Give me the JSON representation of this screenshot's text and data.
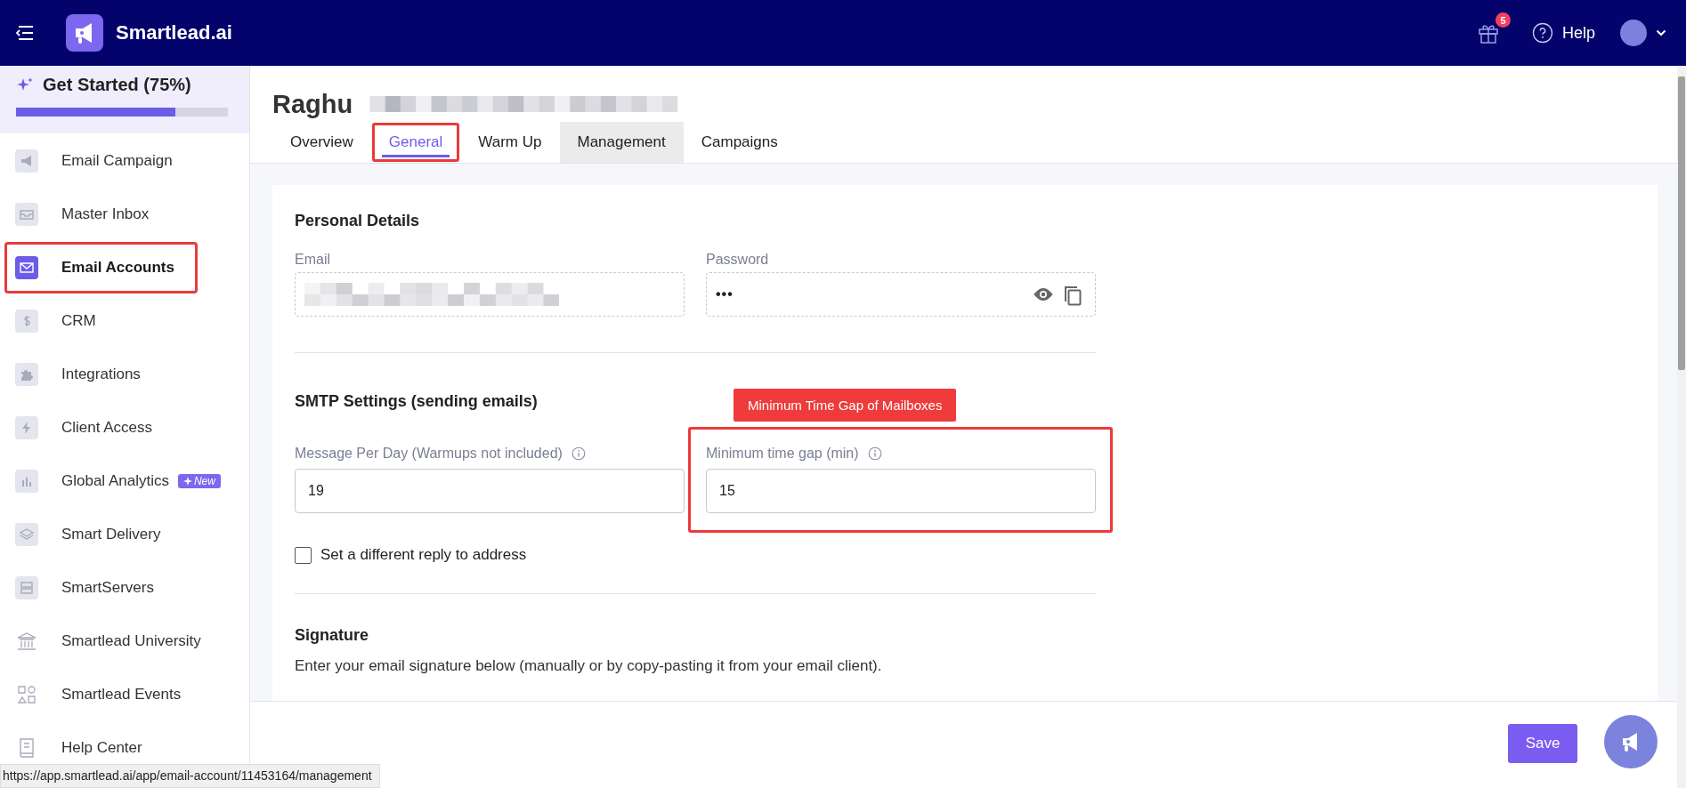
{
  "topbar": {
    "brand": "Smartlead.ai",
    "gift_badge": "5",
    "help": "Help"
  },
  "sidebar": {
    "get_started": {
      "label": "Get Started (75%)",
      "level": 0.75
    },
    "items": [
      {
        "label": "Email Campaign",
        "selected": false,
        "highlighted": false
      },
      {
        "label": "Master Inbox",
        "selected": false,
        "highlighted": false
      },
      {
        "label": "Email Accounts",
        "selected": true,
        "highlighted": true
      },
      {
        "label": "CRM",
        "selected": false,
        "highlighted": false
      },
      {
        "label": "Integrations",
        "selected": false,
        "highlighted": false
      },
      {
        "label": "Client Access",
        "selected": false,
        "highlighted": false
      },
      {
        "label": "Global Analytics",
        "selected": false,
        "highlighted": false,
        "badge": "New"
      },
      {
        "label": "Smart Delivery",
        "selected": false,
        "highlighted": false
      },
      {
        "label": "SmartServers",
        "selected": false,
        "highlighted": false
      },
      {
        "label": "Smartlead University",
        "selected": false,
        "highlighted": false
      },
      {
        "label": "Smartlead Events",
        "selected": false,
        "highlighted": false
      },
      {
        "label": "Help Center",
        "selected": false,
        "highlighted": false
      }
    ]
  },
  "page": {
    "title": "Raghu",
    "tabs": [
      {
        "label": "Overview",
        "selected": false,
        "hovered": false,
        "highlighted": false
      },
      {
        "label": "General",
        "selected": true,
        "hovered": false,
        "highlighted": true
      },
      {
        "label": "Warm Up",
        "selected": false,
        "hovered": false,
        "highlighted": false
      },
      {
        "label": "Management",
        "selected": false,
        "hovered": true,
        "highlighted": false
      },
      {
        "label": "Campaigns",
        "selected": false,
        "hovered": false,
        "highlighted": false
      }
    ]
  },
  "personal_details": {
    "title": "Personal Details",
    "email": {
      "label": "Email"
    },
    "password": {
      "label": "Password",
      "value": "•••"
    }
  },
  "smtp": {
    "title": "SMTP Settings (sending emails)",
    "annotation": "Minimum Time Gap of Mailboxes",
    "fields": [
      {
        "label": "Message Per Day (Warmups not included)",
        "value": "19",
        "highlighted": false
      },
      {
        "label": "Minimum time gap (min)",
        "value": "15",
        "highlighted": true
      }
    ],
    "reply_to": {
      "label": "Set a different reply to address",
      "checked": false
    }
  },
  "signature": {
    "title": "Signature",
    "description": "Enter your email signature below (manually or by copy-pasting it from your email client)."
  },
  "footer": {
    "save": "Save"
  },
  "status_url": "https://app.smartlead.ai/app/email-account/11453164/management"
}
